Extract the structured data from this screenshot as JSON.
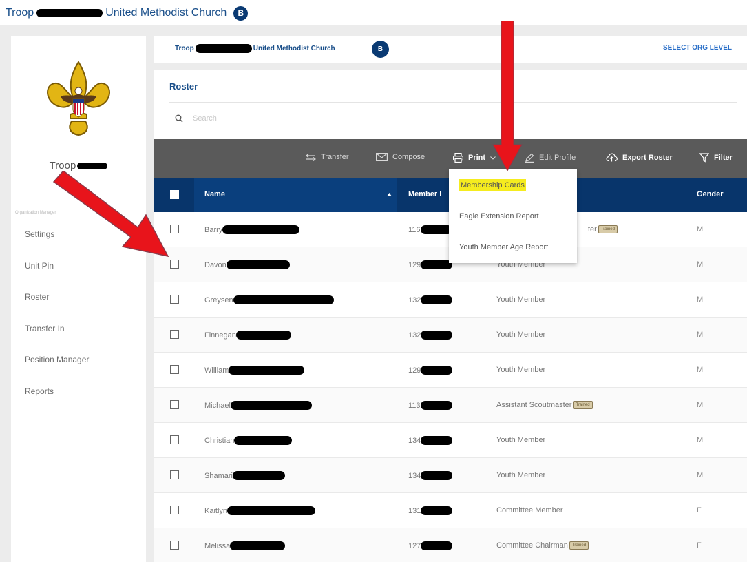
{
  "caption": {
    "prefix": "Troop",
    "suffix": "United Methodist Church",
    "badge": "B"
  },
  "sidebar": {
    "troop_label": "Troop",
    "section_label": "Organization Manager",
    "items": [
      {
        "label": "Settings"
      },
      {
        "label": "Unit Pin"
      },
      {
        "label": "Roster"
      },
      {
        "label": "Transfer In"
      },
      {
        "label": "Position Manager"
      },
      {
        "label": "Reports"
      }
    ]
  },
  "topbar": {
    "org_prefix": "Troop",
    "org_suffix": "United Methodist Church",
    "badge": "B",
    "select_org": "SELECT ORG LEVEL"
  },
  "roster": {
    "title": "Roster",
    "search_placeholder": "Search"
  },
  "toolbar": {
    "transfer": "Transfer",
    "compose": "Compose",
    "print": "Print",
    "edit_profile": "Edit Profile",
    "export": "Export Roster",
    "filter": "Filter"
  },
  "table": {
    "headers": {
      "name": "Name",
      "member_id": "Member I",
      "gender": "Gender"
    },
    "trained_label": "Trained",
    "rows": [
      {
        "name": "Barry",
        "id": "116",
        "position": "ter",
        "trained": true,
        "gender": "M"
      },
      {
        "name": "Davon",
        "id": "129",
        "position": "Youth Member",
        "trained": false,
        "gender": "M"
      },
      {
        "name": "Greysen",
        "id": "132",
        "position": "Youth Member",
        "trained": false,
        "gender": "M"
      },
      {
        "name": "Finnegan",
        "id": "132",
        "position": "Youth Member",
        "trained": false,
        "gender": "M"
      },
      {
        "name": "William",
        "id": "129",
        "position": "Youth Member",
        "trained": false,
        "gender": "M"
      },
      {
        "name": "Michael",
        "id": "113",
        "position": "Assistant Scoutmaster",
        "trained": true,
        "gender": "M"
      },
      {
        "name": "Christian",
        "id": "134",
        "position": "Youth Member",
        "trained": false,
        "gender": "M"
      },
      {
        "name": "Shamari",
        "id": "134",
        "position": "Youth Member",
        "trained": false,
        "gender": "M"
      },
      {
        "name": "Kaitlyn",
        "id": "131",
        "position": "Committee Member",
        "trained": false,
        "gender": "F"
      },
      {
        "name": "Melissa",
        "id": "127",
        "position": "Committee Chairman",
        "trained": true,
        "gender": "F"
      }
    ]
  },
  "print_menu": {
    "items": [
      {
        "label": "Membership Cards",
        "highlighted": true
      },
      {
        "label": "Eagle Extension Report",
        "highlighted": false
      },
      {
        "label": "Youth Member Age Report",
        "highlighted": false
      }
    ]
  },
  "colors": {
    "navy": "#08356b",
    "toolbar": "#5a5a5a",
    "highlight": "#f5ec1f",
    "arrow": "#e8141b"
  }
}
